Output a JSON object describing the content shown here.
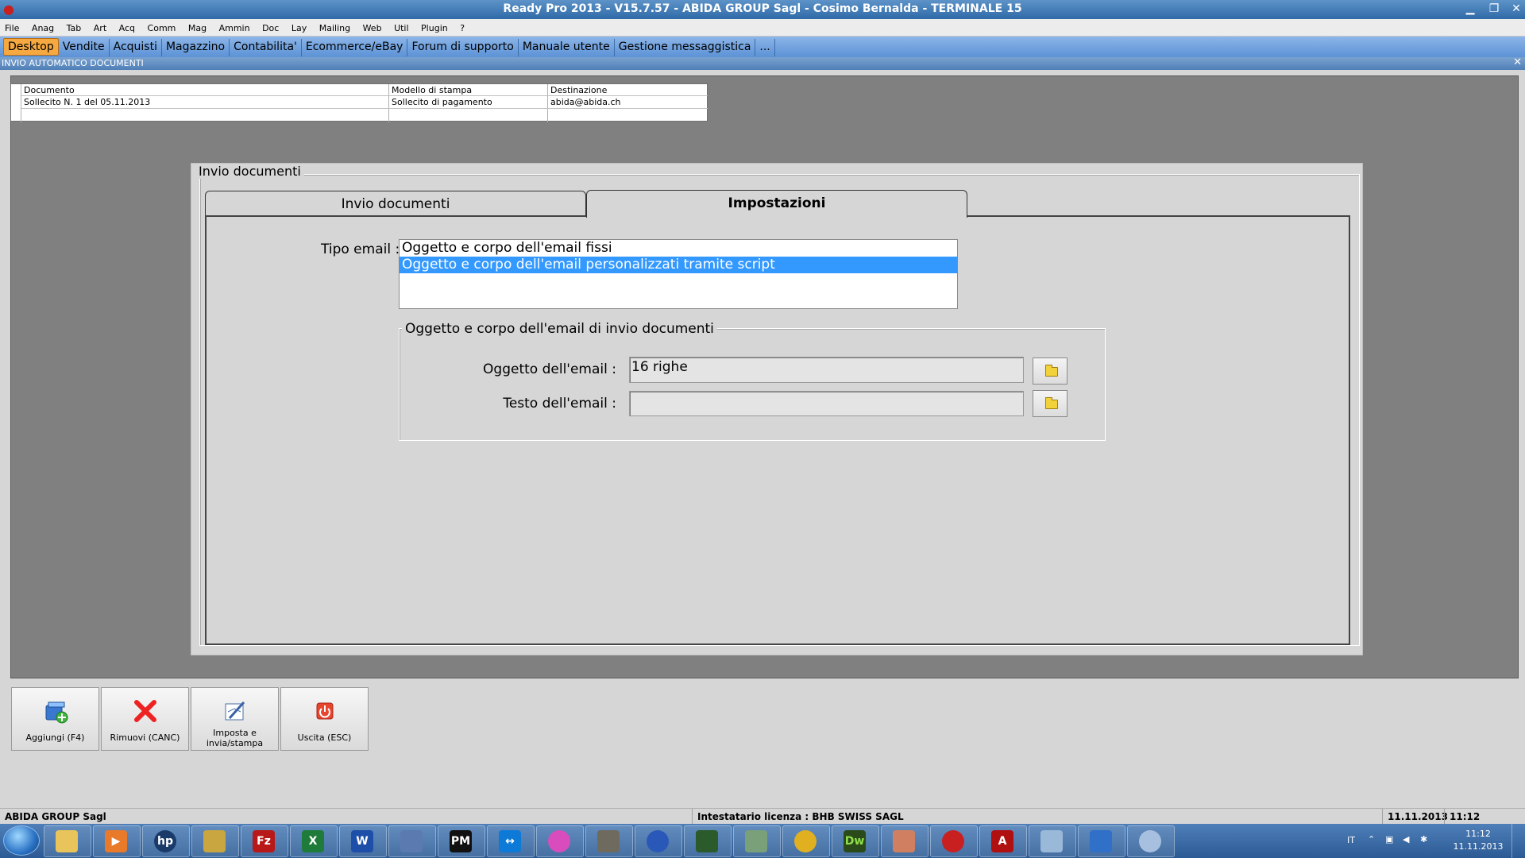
{
  "window": {
    "title": "Ready Pro 2013 - V15.7.57 - ABIDA GROUP Sagl - Cosimo Bernalda - TERMINALE 15"
  },
  "menu": [
    "File",
    "Anag",
    "Tab",
    "Art",
    "Acq",
    "Comm",
    "Mag",
    "Ammin",
    "Doc",
    "Lay",
    "Mailing",
    "Web",
    "Util",
    "Plugin",
    "?"
  ],
  "quicktabs": [
    "Desktop",
    "Vendite",
    "Acquisti",
    "Magazzino",
    "Contabilita'",
    "Ecommerce/eBay",
    "Forum di supporto",
    "Manuale utente",
    "Gestione messaggistica",
    "..."
  ],
  "section_title": "INVIO AUTOMATICO DOCUMENTI",
  "grid": {
    "headers": [
      "Documento",
      "Modello di stampa",
      "Destinazione"
    ],
    "rows": [
      [
        "Sollecito N. 1 del 05.11.2013",
        "Sollecito di pagamento",
        "abida@abida.ch"
      ]
    ]
  },
  "dialog": {
    "group_title": "Invio documenti",
    "tabs": [
      "Invio documenti",
      "Impostazioni"
    ],
    "active_tab": "Impostazioni",
    "tipo_email_label": "Tipo email :",
    "tipo_email_options": [
      "Oggetto e corpo dell'email fissi",
      "Oggetto e corpo dell'email personalizzati tramite script"
    ],
    "tipo_email_selected": 1,
    "subgroup_title": "Oggetto e corpo dell'email di invio documenti",
    "oggetto_label": "Oggetto dell'email :",
    "oggetto_value": "16 righe",
    "testo_label": "Testo dell'email :",
    "testo_value": ""
  },
  "buttons": [
    "Aggiungi (F4)",
    "Rimuovi (CANC)",
    "Imposta e invia/stampa",
    "Uscita (ESC)"
  ],
  "status": {
    "company": "ABIDA GROUP Sagl",
    "license": "Intestatario licenza : BHB SWISS SAGL",
    "date": "11.11.2013",
    "time": "11:12"
  },
  "tray": {
    "lang": "IT",
    "time": "11:12",
    "date": "11.11.2013"
  },
  "taskbar_icons": [
    "explorer-icon",
    "media-player-icon",
    "hp-icon",
    "archive-icon",
    "filezilla-icon",
    "excel-icon",
    "word-icon",
    "network-icon",
    "pm-icon",
    "teamviewer-icon",
    "picasa-icon",
    "gimp-icon",
    "sync-icon",
    "terminal-icon",
    "print-icon",
    "chrome-icon",
    "dreamweaver-icon",
    "cards-icon",
    "strawberry-icon",
    "acrobat-icon",
    "notepad-icon",
    "transfer-icon",
    "paint-icon"
  ],
  "colors": {
    "accent": "#5c92d6",
    "selection": "#3399ff",
    "active_tab": "#f6a940"
  }
}
